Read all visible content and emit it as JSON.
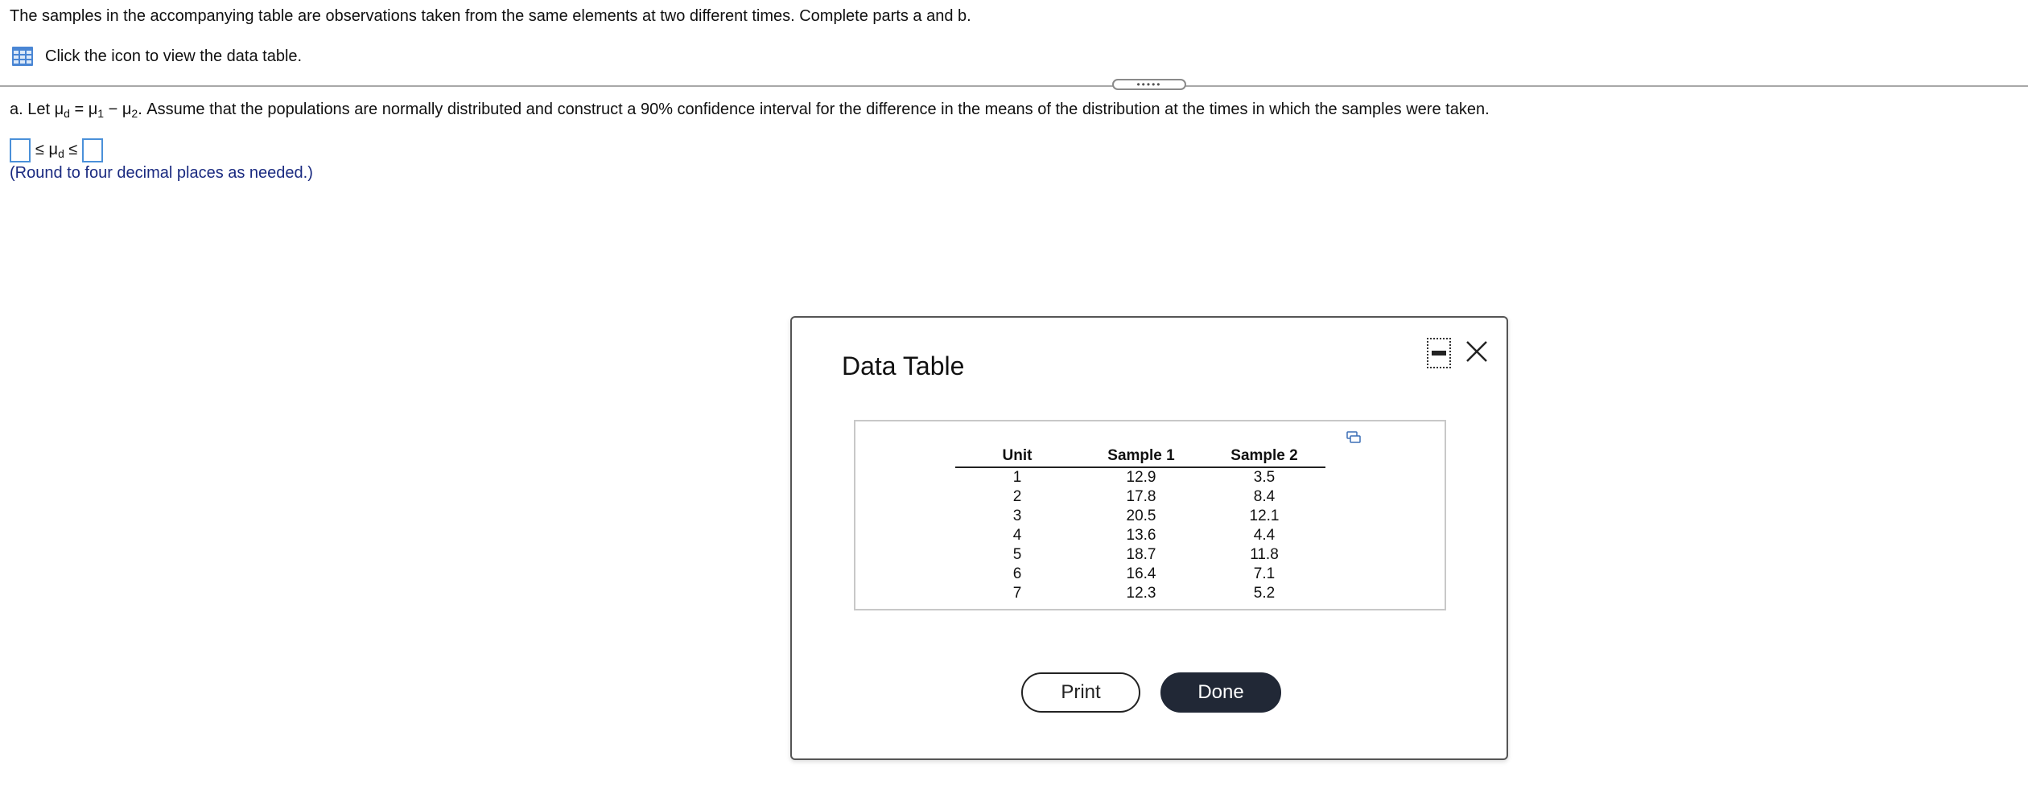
{
  "intro": "The samples in the accompanying table are observations taken from the same elements at two different times. Complete parts a and b.",
  "data_link": {
    "label": "Click the icon to view the data table.",
    "icon": "table-grid-icon"
  },
  "drag_handle": {
    "dots": "•••••"
  },
  "question": {
    "prefix": "a. Let ",
    "mu": "μ",
    "sub_d": "d",
    "eq": " = ",
    "sub_1": "1",
    "minus": " − ",
    "sub_2": "2",
    "suffix": ". Assume that the populations are normally distributed and construct a 90% confidence interval for the difference in the means of the distribution at the times in which the samples were taken."
  },
  "answer": {
    "mid_prefix": "≤ μ",
    "mid_sub": "d",
    "mid_suffix": " ≤",
    "lower_value": "",
    "upper_value": ""
  },
  "hint": "(Round to four decimal places as needed.)",
  "modal": {
    "title": "Data Table",
    "headers": [
      "Unit",
      "Sample 1",
      "Sample 2"
    ],
    "rows": [
      [
        "1",
        "12.9",
        "3.5"
      ],
      [
        "2",
        "17.8",
        "8.4"
      ],
      [
        "3",
        "20.5",
        "12.1"
      ],
      [
        "4",
        "13.6",
        "4.4"
      ],
      [
        "5",
        "18.7",
        "11.8"
      ],
      [
        "6",
        "16.4",
        "7.1"
      ],
      [
        "7",
        "12.3",
        "5.2"
      ]
    ],
    "print_label": "Print",
    "done_label": "Done",
    "colors": {
      "done_bg": "#212836",
      "input_border": "#4a90d9",
      "hint": "#1a2a80"
    }
  }
}
